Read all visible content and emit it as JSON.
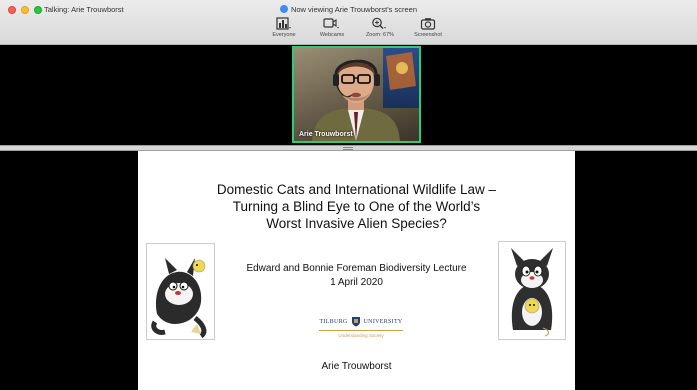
{
  "titlebar": {
    "talking": "Talking: Arie  Trouwborst",
    "viewing": "Now viewing Arie  Trouwborst's screen"
  },
  "toolbar": {
    "items": [
      {
        "label": "Everyone",
        "icon": "gallery-view-icon"
      },
      {
        "label": "Webcams",
        "icon": "camera-icon"
      },
      {
        "label": "Zoom: 67%",
        "icon": "zoom-icon"
      },
      {
        "label": "Screenshot",
        "icon": "screenshot-icon"
      }
    ]
  },
  "video": {
    "participant_name": "Arie  Trouwborst",
    "active_border_color": "#2ecc71"
  },
  "slide": {
    "title_lines": [
      "Domestic Cats and International Wildlife Law –",
      "Turning a Blind Eye to One of the World’s",
      "Worst Invasive Alien Species?"
    ],
    "lecture": "Edward and Bonnie Foreman Biodiversity Lecture",
    "date": "1 April 2020",
    "logo_left": "TILBURG",
    "logo_right": "UNIVERSITY",
    "logo_tagline": "Understanding Society",
    "presenter": "Arie Trouwborst"
  }
}
